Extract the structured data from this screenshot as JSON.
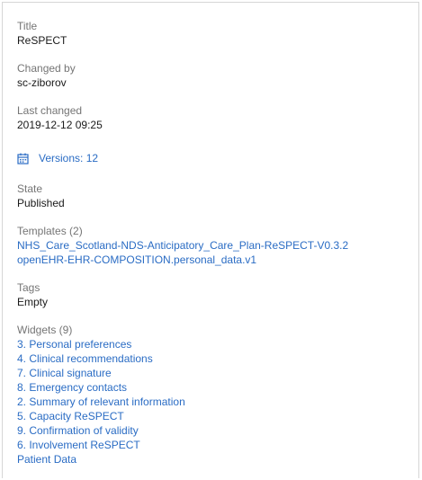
{
  "details": {
    "title_label": "Title",
    "title_value": "ReSPECT",
    "changed_by_label": "Changed by",
    "changed_by_value": "sc-ziborov",
    "last_changed_label": "Last changed",
    "last_changed_value": "2019-12-12 09:25",
    "versions_link": "Versions: 12",
    "versions_icon": "calendar-icon",
    "state_label": "State",
    "state_value": "Published",
    "templates_label": "Templates (2)",
    "templates": [
      "NHS_Care_Scotland-NDS-Anticipatory_Care_Plan-ReSPECT-V0.3.2",
      "openEHR-EHR-COMPOSITION.personal_data.v1"
    ],
    "tags_label": "Tags",
    "tags_value": "Empty",
    "widgets_label": "Widgets (9)",
    "widgets": [
      "3. Personal preferences",
      "4. Clinical recommendations",
      "7. Clinical signature",
      "8. Emergency contacts",
      "2. Summary of relevant information",
      "5. Capacity ReSPECT",
      "9. Confirmation of validity",
      "6. Involvement ReSPECT",
      "Patient Data"
    ]
  },
  "colors": {
    "link": "#2a6cc4",
    "label": "#757575",
    "text": "#1a1a1a",
    "border": "#d6d6d6"
  }
}
